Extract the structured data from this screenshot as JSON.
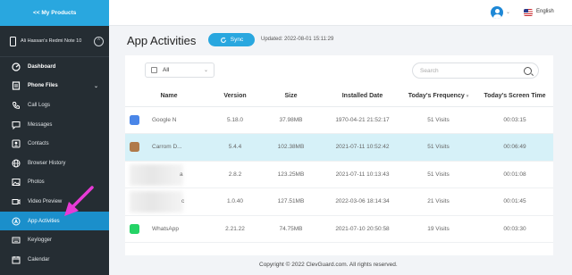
{
  "sidebar": {
    "back_label": "<< My Products",
    "device_name": "Ali Hassan's Redmi Note 10",
    "collapse_icon": "chevron-up-icon",
    "items": [
      {
        "label": "Dashboard",
        "icon": "dashboard-icon"
      },
      {
        "label": "Phone Files",
        "icon": "files-icon"
      },
      {
        "label": "Call Logs",
        "icon": "phone-icon"
      },
      {
        "label": "Messages",
        "icon": "message-icon"
      },
      {
        "label": "Contacts",
        "icon": "contacts-icon"
      },
      {
        "label": "Browser History",
        "icon": "globe-icon"
      },
      {
        "label": "Photos",
        "icon": "photo-icon"
      },
      {
        "label": "Video Preview",
        "icon": "video-icon"
      },
      {
        "label": "App Activities",
        "icon": "app-icon"
      },
      {
        "label": "Keylogger",
        "icon": "keyboard-icon"
      },
      {
        "label": "Calendar",
        "icon": "calendar-icon"
      }
    ]
  },
  "topbar": {
    "language": "English"
  },
  "page": {
    "title": "App Activities",
    "sync_label": "Sync",
    "updated": "Updated: 2022-08-01 15:11:29"
  },
  "filter": {
    "selected": "All",
    "search_placeholder": "Search"
  },
  "table": {
    "columns": [
      "Name",
      "Version",
      "Size",
      "Installed Date",
      "Today's Frequency",
      "Today's Screen Time"
    ],
    "rows": [
      {
        "name": "Google N",
        "version": "5.18.0",
        "size": "37.98MB",
        "date": "1970-04-21 21:52:17",
        "freq": "51 Visits",
        "time": "00:03:15",
        "icon_color": "#4a86e8"
      },
      {
        "name": "Carrom D...",
        "version": "5.4.4",
        "size": "102.38MB",
        "date": "2021-07-11 10:52:42",
        "freq": "51 Visits",
        "time": "00:06:49",
        "icon_color": "#b07a4a"
      },
      {
        "name": "a",
        "version": "2.8.2",
        "size": "123.25MB",
        "date": "2021-07-11 10:13:43",
        "freq": "51 Visits",
        "time": "00:01:08",
        "icon_color": ""
      },
      {
        "name": "c",
        "version": "1.0.40",
        "size": "127.51MB",
        "date": "2022-03-06 18:14:34",
        "freq": "21 Visits",
        "time": "00:01:45",
        "icon_color": ""
      },
      {
        "name": "WhatsApp",
        "version": "2.21.22",
        "size": "74.75MB",
        "date": "2021-07-10 20:50:58",
        "freq": "19 Visits",
        "time": "00:03:30",
        "icon_color": "#25d366"
      }
    ]
  },
  "footer": "Copyright © 2022 ClevGuard.com. All rights reserved.",
  "colors": {
    "accent": "#29a7df",
    "sidebar": "#252d33",
    "active": "#1b8fcb",
    "selected_row": "#d6f1f8",
    "arrow": "#e83ad6"
  }
}
